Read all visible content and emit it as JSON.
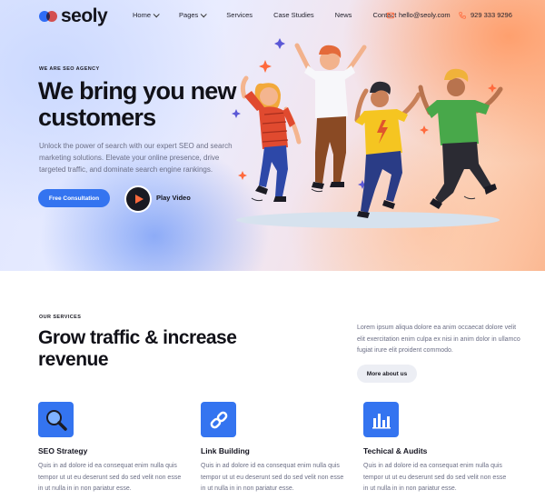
{
  "brand": {
    "name": "seoly"
  },
  "nav": {
    "items": [
      {
        "label": "Home",
        "dropdown": true
      },
      {
        "label": "Pages",
        "dropdown": true
      },
      {
        "label": "Services",
        "dropdown": false
      },
      {
        "label": "Case Studies",
        "dropdown": false
      },
      {
        "label": "News",
        "dropdown": false
      },
      {
        "label": "Contact",
        "dropdown": false
      }
    ],
    "email": "hello@seoly.com",
    "phone": "929 333 9296"
  },
  "hero": {
    "eyebrow": "WE ARE SEO AGENCY",
    "headline": "We bring you new customers",
    "intro": "Unlock the power of search with our expert SEO and search marketing solutions. Elevate your online presence, drive targeted traffic, and dominate search engine rankings.",
    "cta_primary": "Free Consultation",
    "cta_video": "Play Video"
  },
  "services": {
    "eyebrow": "OUR SERVICES",
    "title": "Grow traffic & increase revenue",
    "text": "Lorem ipsum aliqua dolore ea anim occaecat dolore velit elit exercitation enim culpa ex nisi in anim dolor in ullamco fugiat irure elit proident commodo.",
    "button": "More about us",
    "cards": [
      {
        "title": "SEO Strategy",
        "text": "Quis in ad dolore id ea consequat enim nulla quis tempor ut ut eu deserunt sed do sed velit non esse in ut nulla in in non pariatur esse.",
        "icon": "magnifier-icon"
      },
      {
        "title": "Link Building",
        "text": "Quis in ad dolore id ea consequat enim nulla quis tempor ut ut eu deserunt sed do sed velit non esse in ut nulla in in non pariatur esse.",
        "icon": "link-icon"
      },
      {
        "title": "Techical & Audits",
        "text": "Quis in ad dolore id ea consequat enim nulla quis tempor ut ut eu deserunt sed do sed velit non esse in ut nulla in in non pariatur esse.",
        "icon": "bar-chart-icon"
      }
    ]
  },
  "colors": {
    "primary": "#3474f0",
    "accent": "#ff6a3d",
    "text": "#111118",
    "muted": "#6c6f86"
  }
}
